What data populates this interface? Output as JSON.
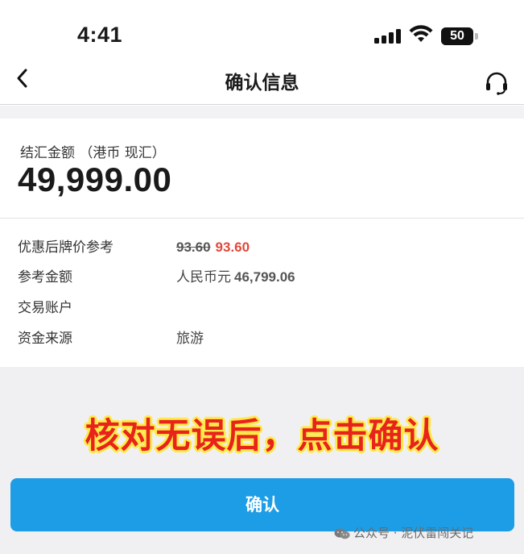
{
  "status_bar": {
    "time": "4:41",
    "battery": "50"
  },
  "nav": {
    "title": "确认信息",
    "back_icon": "chevron-left-icon",
    "service_icon": "headset-icon"
  },
  "amount": {
    "label": "结汇金额 （港币 现汇）",
    "value": "49,999.00"
  },
  "info": {
    "rate_label": "优惠后牌价参考",
    "rate_original": "93.60",
    "rate_discounted": "93.60",
    "ref_amount_label": "参考金额",
    "ref_amount_currency": "人民币元",
    "ref_amount_value": "46,799.06",
    "account_label": "交易账户",
    "account_value": "",
    "source_label": "资金来源",
    "source_value": "旅游"
  },
  "annotation": "核对无误后，点击确认",
  "confirm_label": "确认",
  "watermark": "公众号 · 泥伏雷闯关记",
  "colors": {
    "accent": "#1c9de5",
    "discount": "#e0473b",
    "annotation": "#e8231b",
    "annotation_outline": "#ffe94a"
  }
}
